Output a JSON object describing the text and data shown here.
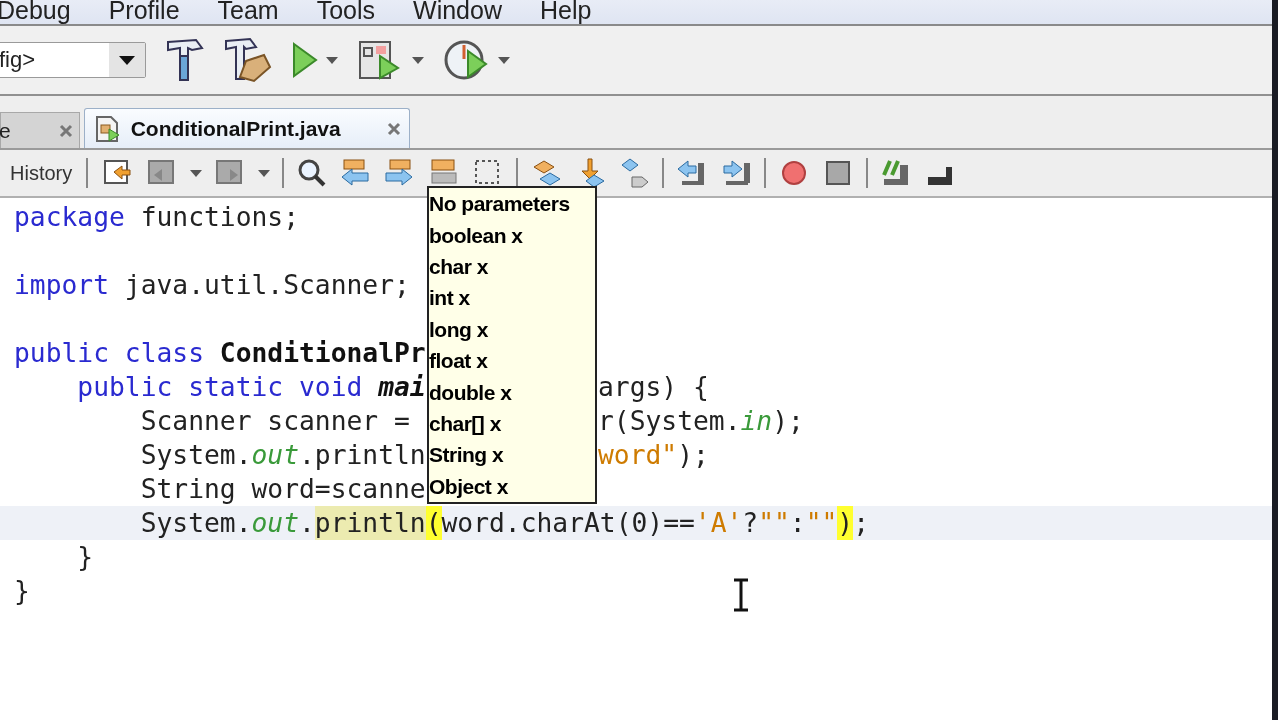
{
  "menu_bar": [
    {
      "label": "Debug"
    },
    {
      "label": "Profile"
    },
    {
      "label": "Team"
    },
    {
      "label": "Tools"
    },
    {
      "label": "Window"
    },
    {
      "label": "Help"
    }
  ],
  "toolbar": {
    "config_combo": "fig>"
  },
  "tabs": [
    {
      "label": "e",
      "selected": false
    },
    {
      "label": "ConditionalPrint.java",
      "selected": true
    }
  ],
  "editor_toolbar": {
    "history_label": "History"
  },
  "code_lines": [
    {
      "kind": "code",
      "current": false,
      "tokens": [
        {
          "kind": "keyword",
          "text": "package"
        },
        {
          "kind": "text",
          "text": " functions;"
        }
      ]
    },
    {
      "kind": "blank",
      "current": false
    },
    {
      "kind": "code",
      "current": false,
      "tokens": [
        {
          "kind": "keyword",
          "text": "import"
        },
        {
          "kind": "text",
          "text": " java.util.Scanner;"
        }
      ]
    },
    {
      "kind": "blank",
      "current": false
    },
    {
      "kind": "code",
      "current": false,
      "tokens": [
        {
          "kind": "keyword",
          "text": "public class "
        },
        {
          "kind": "declaration",
          "text": "ConditionalPr"
        }
      ]
    },
    {
      "kind": "code",
      "current": false,
      "tokens": [
        {
          "kind": "keyword",
          "text": "    public static void "
        },
        {
          "kind": "method",
          "text": "mai"
        }
      ],
      "tail": [
        {
          "kind": "text",
          "text": "args) {"
        }
      ]
    },
    {
      "kind": "code",
      "current": false,
      "tokens": [
        {
          "kind": "text",
          "text": "        Scanner scanner ="
        }
      ],
      "tail": [
        {
          "kind": "text",
          "text": "r(System."
        },
        {
          "kind": "field",
          "text": "in"
        },
        {
          "kind": "text",
          "text": ");"
        }
      ]
    },
    {
      "kind": "code",
      "current": false,
      "tokens": [
        {
          "kind": "text",
          "text": "        System."
        },
        {
          "kind": "field",
          "text": "out"
        },
        {
          "kind": "text",
          "text": ".println"
        }
      ],
      "tail": [
        {
          "kind": "string",
          "text": "word\""
        },
        {
          "kind": "text",
          "text": ");"
        }
      ]
    },
    {
      "kind": "code",
      "current": false,
      "tokens": [
        {
          "kind": "text",
          "text": "        String word=scanne"
        }
      ]
    },
    {
      "kind": "code",
      "current": true,
      "tokens": [
        {
          "kind": "text",
          "text": "        System."
        },
        {
          "kind": "field",
          "text": "out"
        },
        {
          "kind": "text",
          "text": "."
        },
        {
          "kind": "call",
          "text": "println"
        },
        {
          "kind": "brace",
          "text": "("
        },
        {
          "kind": "text",
          "text": "word.charAt(0)=="
        },
        {
          "kind": "string",
          "text": "'A'"
        },
        {
          "kind": "text",
          "text": "?"
        },
        {
          "kind": "string",
          "text": "\"\""
        },
        {
          "kind": "text",
          "text": ":"
        },
        {
          "kind": "string",
          "text": "\"\""
        },
        {
          "kind": "brace",
          "text": ")"
        },
        {
          "kind": "text",
          "text": ";"
        }
      ]
    },
    {
      "kind": "code",
      "current": false,
      "tokens": [
        {
          "kind": "text",
          "text": "    }"
        }
      ]
    },
    {
      "kind": "code",
      "current": false,
      "tokens": [
        {
          "kind": "text",
          "text": "}"
        }
      ]
    }
  ],
  "param_popup": {
    "items": [
      "No parameters",
      "boolean x",
      "char x",
      "int x",
      "long x",
      "float x",
      "double x",
      "char[] x",
      "String x",
      "Object x"
    ]
  }
}
